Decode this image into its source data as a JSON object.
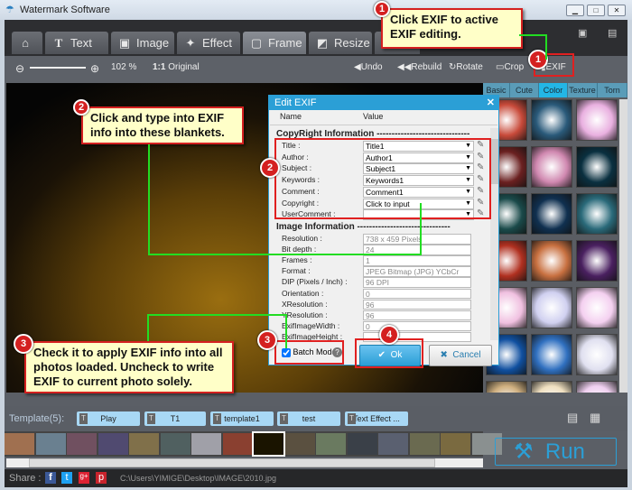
{
  "window": {
    "title": "Watermark Software"
  },
  "tabs": [
    {
      "label": ""
    },
    {
      "label": "Text"
    },
    {
      "label": "Image"
    },
    {
      "label": "Effect"
    },
    {
      "label": "Frame"
    },
    {
      "label": "Resize"
    }
  ],
  "toolbar": {
    "zoom": "102 %",
    "original": "Original",
    "undo": "Undo",
    "rebuild": "Rebuild",
    "rotate": "Rotate",
    "crop": "Crop",
    "exif": "EXIF"
  },
  "frame_tabs": [
    "Basic",
    "Cute",
    "Color",
    "Texture",
    "Torn"
  ],
  "dialog": {
    "title": "Edit EXIF",
    "col_name": "Name",
    "col_value": "Value",
    "section1": "CopyRight Information -------------------------------",
    "copyright": [
      {
        "name": "Title :",
        "value": "Title1"
      },
      {
        "name": "Author :",
        "value": "Author1"
      },
      {
        "name": "Subject :",
        "value": "Subject1"
      },
      {
        "name": "Keywords :",
        "value": "Keywords1"
      },
      {
        "name": "Comment :",
        "value": "Comment1"
      },
      {
        "name": "Copyright :",
        "value": "Click to input"
      },
      {
        "name": "UserComment :",
        "value": ""
      }
    ],
    "section2": "Image Information -------------------------------",
    "image": [
      {
        "name": "Resolution :",
        "value": "738 x 459 Pixels"
      },
      {
        "name": "Bit depth :",
        "value": "24"
      },
      {
        "name": "Frames :",
        "value": "1"
      },
      {
        "name": "Format :",
        "value": "JPEG Bitmap (JPG) YCbCr"
      },
      {
        "name": "DIP (Pixels / Inch) :",
        "value": "96 DPI"
      },
      {
        "name": "Orientation :",
        "value": "0"
      },
      {
        "name": "XResolution :",
        "value": "96"
      },
      {
        "name": "YResolution :",
        "value": "96"
      },
      {
        "name": "ExifImageWidth :",
        "value": "0"
      },
      {
        "name": "ExifImageHeight :",
        "value": ""
      }
    ],
    "batch_mode": "Batch Mode",
    "batch_checked": true,
    "ok": "Ok",
    "cancel": "Cancel"
  },
  "callouts": {
    "c1": "Click EXIF to active EXIF editing.",
    "c2": "Click and type into EXIF info into these blankets.",
    "c3": "Check it to apply EXIF info into all photos loaded. Uncheck to write EXIF to current photo solely.",
    "n1": "1",
    "n2": "2",
    "n3": "3",
    "n4": "4"
  },
  "templates": {
    "label": "Template(5):",
    "items": [
      "Play",
      "T1",
      "template1",
      "test",
      "Text Effect ..."
    ]
  },
  "run": "Run",
  "share": {
    "label": "Share :",
    "path": "C:\\Users\\YIMIGE\\Desktop\\IMAGE\\2010.jpg"
  },
  "colors": {
    "accent": "#2b9fd6",
    "callout_border": "#d42020",
    "connector": "#22dd22"
  }
}
